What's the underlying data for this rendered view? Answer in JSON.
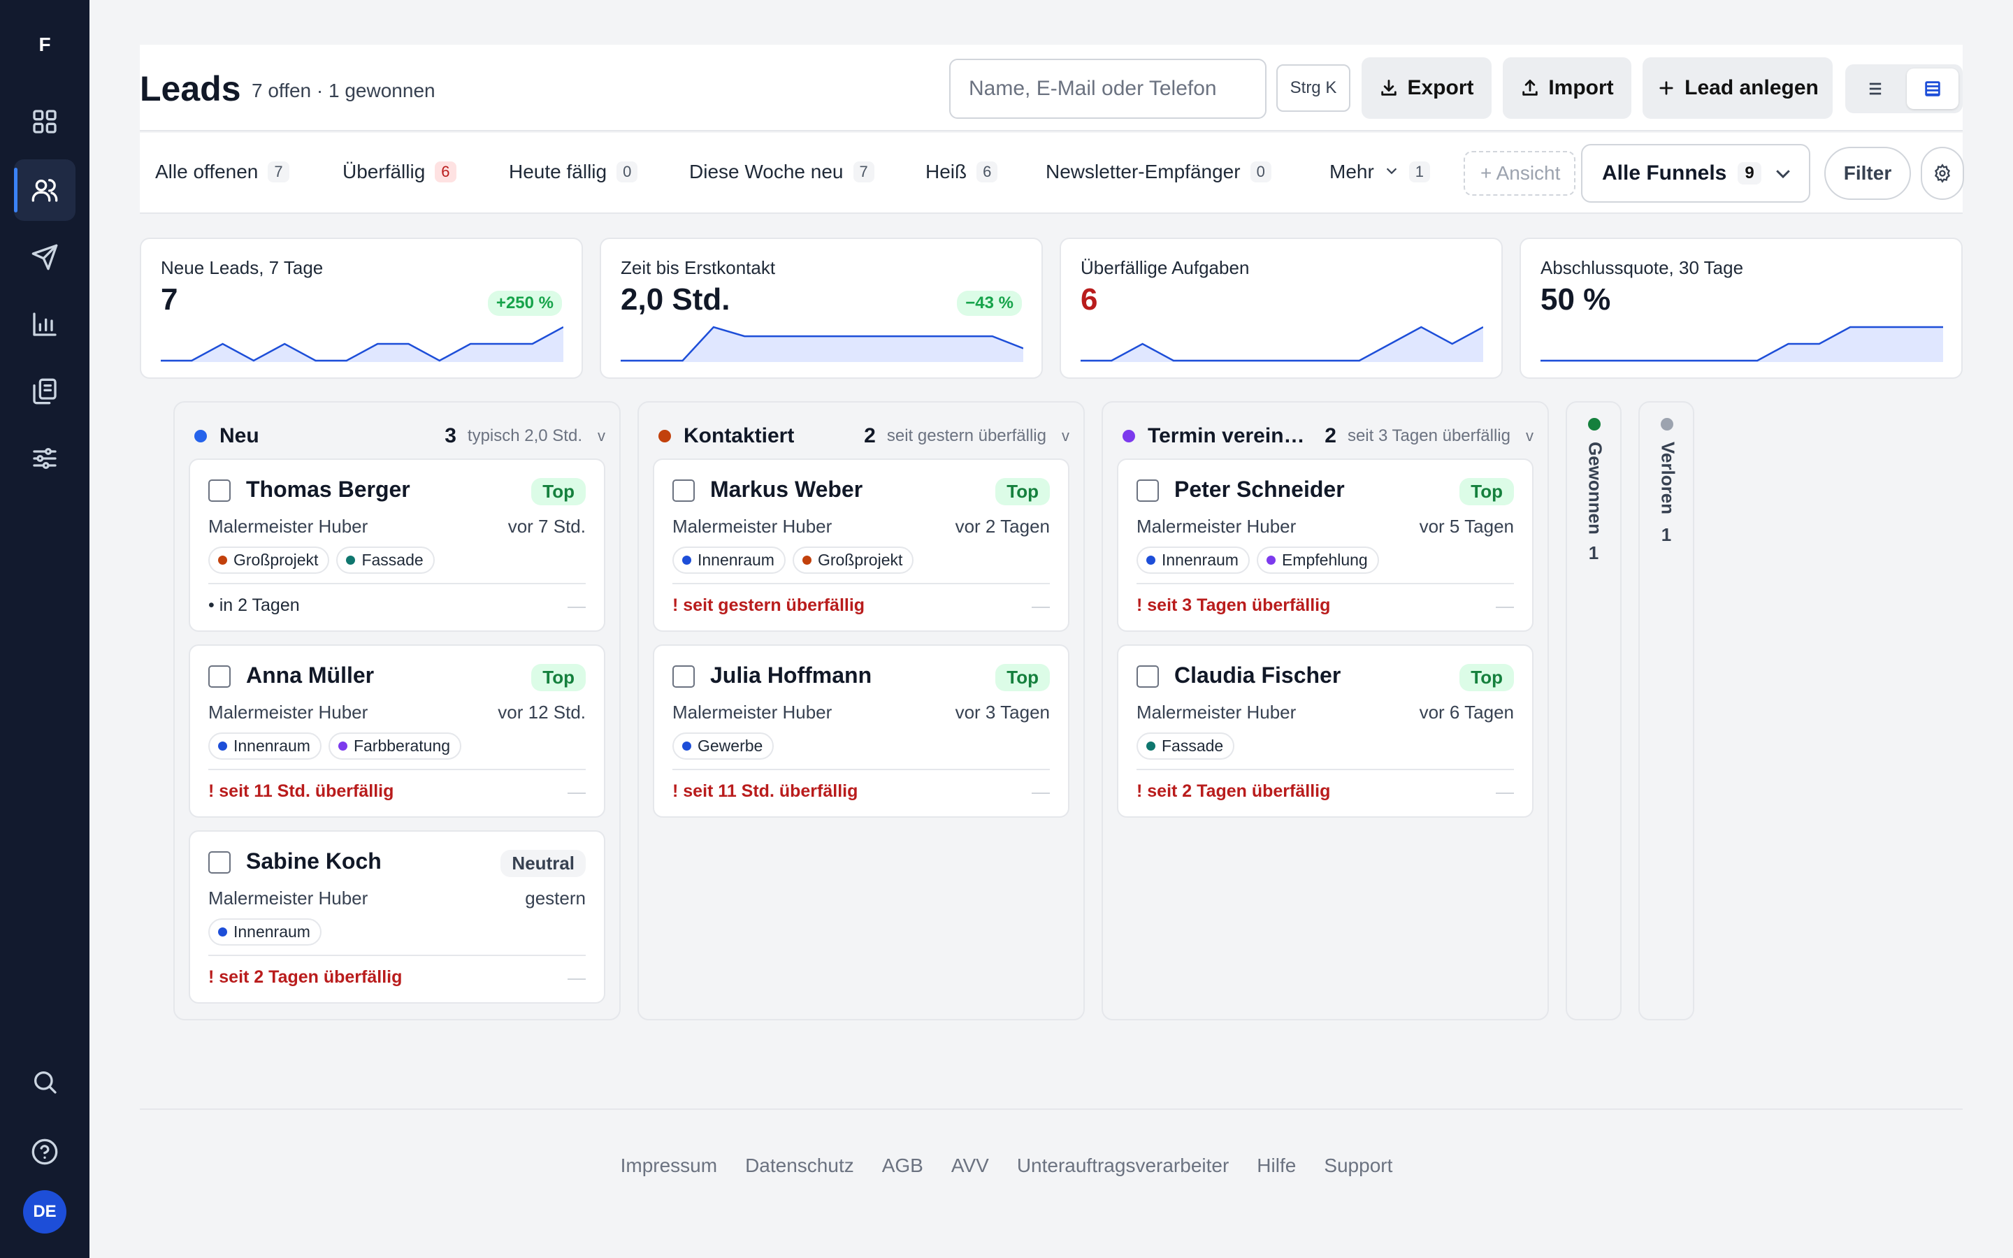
{
  "app": {
    "logo": "F",
    "avatar": "DE"
  },
  "sidebar": {
    "items": [
      {
        "icon": "dashboard-icon"
      },
      {
        "icon": "users-icon",
        "active": true
      },
      {
        "icon": "send-icon"
      },
      {
        "icon": "bar-chart-icon"
      },
      {
        "icon": "documents-icon"
      },
      {
        "icon": "sliders-icon"
      }
    ],
    "bottom": [
      {
        "icon": "search-icon"
      },
      {
        "icon": "help-icon"
      }
    ]
  },
  "header": {
    "title": "Leads",
    "subtitle": "7 offen · 1 gewonnen",
    "search_placeholder": "Name, E-Mail oder Telefon",
    "shortcut": "Strg K",
    "export_label": "Export",
    "import_label": "Import",
    "create_label": "Lead anlegen"
  },
  "tabs": [
    {
      "label": "Alle offenen",
      "count": "7"
    },
    {
      "label": "Überfällig",
      "count": "6",
      "alert": true
    },
    {
      "label": "Heute fällig",
      "count": "0"
    },
    {
      "label": "Diese Woche neu",
      "count": "7"
    },
    {
      "label": "Heiß",
      "count": "6"
    },
    {
      "label": "Newsletter-Empfänger",
      "count": "0"
    },
    {
      "label": "Mehr",
      "count": "1"
    }
  ],
  "toolbar": {
    "add_view": "+ Ansicht",
    "funnel": "Alle Funnels",
    "funnel_count": "9",
    "filter": "Filter"
  },
  "kpis": [
    {
      "label": "Neue Leads, 7 Tage",
      "value": "7",
      "delta": "+250 %",
      "series": [
        0,
        0,
        1,
        0,
        1,
        0,
        0,
        1,
        1,
        0,
        1,
        1,
        1,
        2
      ]
    },
    {
      "label": "Zeit bis Erstkontakt",
      "value": "2,0 Std.",
      "delta": "−43 %",
      "series": [
        0,
        0,
        0,
        2.2,
        1.6,
        1.6,
        1.6,
        1.6,
        1.6,
        1.6,
        1.6,
        1.6,
        1.6,
        0.8
      ]
    },
    {
      "label": "Überfällige Aufgaben",
      "value": "6",
      "delta": "",
      "alert": true,
      "series": [
        0,
        0,
        1,
        0,
        0,
        0,
        0,
        0,
        0,
        0,
        1,
        2,
        1,
        2
      ]
    },
    {
      "label": "Abschlussquote, 30 Tage",
      "value": "50 %",
      "delta": "",
      "series": [
        0,
        0,
        0,
        0,
        0,
        0,
        0,
        0,
        1,
        1,
        2,
        2,
        2,
        2
      ]
    }
  ],
  "columns": [
    {
      "name": "Neu",
      "count": "3",
      "hint": "typisch 2,0 Std.",
      "color": "#2563eb",
      "cards": [
        {
          "name": "Thomas Berger",
          "badge": "Top",
          "company": "Malermeister Huber",
          "time": "vor 7 Std.",
          "tags": [
            {
              "label": "Großprojekt",
              "color": "#c2410c"
            },
            {
              "label": "Fassade",
              "color": "#0f766e"
            }
          ],
          "status": "in 2 Tagen",
          "overdue": false
        },
        {
          "name": "Anna Müller",
          "badge": "Top",
          "company": "Malermeister Huber",
          "time": "vor 12 Std.",
          "tags": [
            {
              "label": "Innenraum",
              "color": "#1d4ed8"
            },
            {
              "label": "Farbberatung",
              "color": "#7c3aed"
            }
          ],
          "status": "seit 11 Std. überfällig",
          "overdue": true
        },
        {
          "name": "Sabine Koch",
          "badge": "Neutral",
          "company": "Malermeister Huber",
          "time": "gestern",
          "tags": [
            {
              "label": "Innenraum",
              "color": "#1d4ed8"
            }
          ],
          "status": "seit 2 Tagen überfällig",
          "overdue": true
        }
      ]
    },
    {
      "name": "Kontaktiert",
      "count": "2",
      "hint": "seit gestern überfällig",
      "color": "#c2410c",
      "cards": [
        {
          "name": "Markus Weber",
          "badge": "Top",
          "company": "Malermeister Huber",
          "time": "vor 2 Tagen",
          "tags": [
            {
              "label": "Innenraum",
              "color": "#1d4ed8"
            },
            {
              "label": "Großprojekt",
              "color": "#c2410c"
            }
          ],
          "status": "seit gestern überfällig",
          "overdue": true
        },
        {
          "name": "Julia Hoffmann",
          "badge": "Top",
          "company": "Malermeister Huber",
          "time": "vor 3 Tagen",
          "tags": [
            {
              "label": "Gewerbe",
              "color": "#1d4ed8"
            }
          ],
          "status": "seit 11 Std. überfällig",
          "overdue": true
        }
      ]
    },
    {
      "name": "Termin vereinbart",
      "count": "2",
      "hint": "seit 3 Tagen überfällig",
      "color": "#7c3aed",
      "cards": [
        {
          "name": "Peter Schneider",
          "badge": "Top",
          "company": "Malermeister Huber",
          "time": "vor 5 Tagen",
          "tags": [
            {
              "label": "Innenraum",
              "color": "#1d4ed8"
            },
            {
              "label": "Empfehlung",
              "color": "#7c3aed"
            }
          ],
          "status": "seit 3 Tagen überfällig",
          "overdue": true
        },
        {
          "name": "Claudia Fischer",
          "badge": "Top",
          "company": "Malermeister Huber",
          "time": "vor 6 Tagen",
          "tags": [
            {
              "label": "Fassade",
              "color": "#0f766e"
            }
          ],
          "status": "seit 2 Tagen überfällig",
          "overdue": true
        }
      ]
    }
  ],
  "collapsed_columns": [
    {
      "name": "Gewonnen",
      "count": "1",
      "color": "#15803d"
    },
    {
      "name": "Verloren",
      "count": "1",
      "color": "#9ca3af"
    }
  ],
  "footer": [
    "Impressum",
    "Datenschutz",
    "AGB",
    "AVV",
    "Unterauftragsverarbeiter",
    "Hilfe",
    "Support"
  ]
}
